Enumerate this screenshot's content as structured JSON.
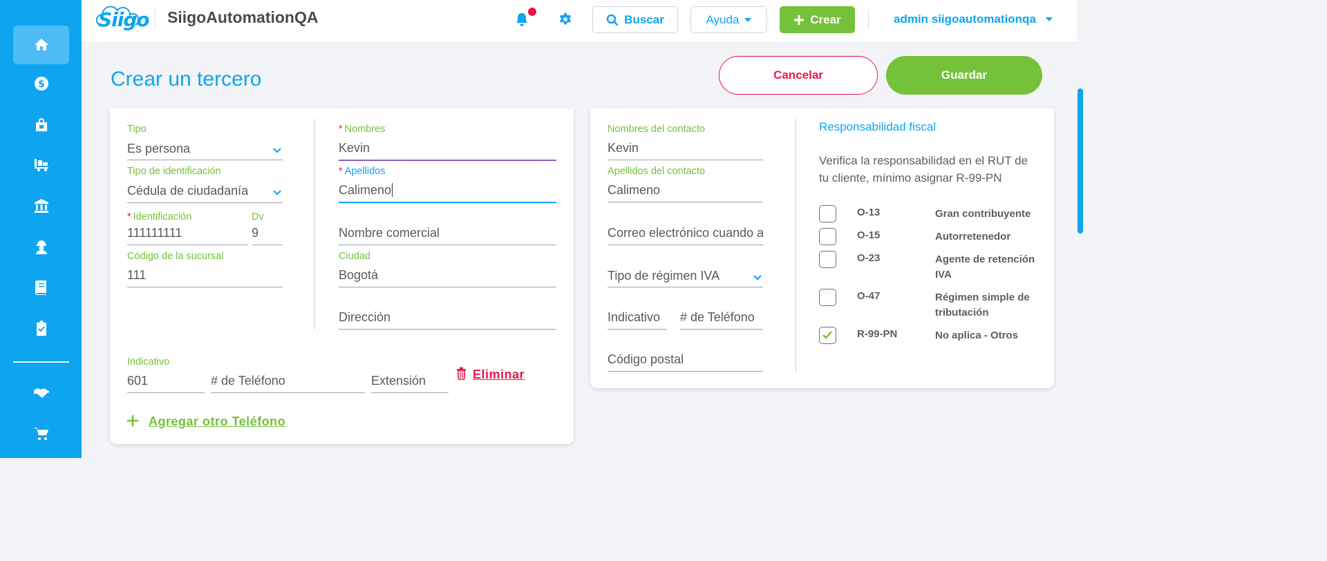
{
  "app": {
    "logo_text": "Siigo",
    "company_name": "SiigoAutomationQA",
    "accent_color": "#0ea5f0",
    "success_color": "#74c13a",
    "danger_color": "#e8174b"
  },
  "header": {
    "search_label": "Buscar",
    "help_label": "Ayuda",
    "create_label": "Crear",
    "user_label": "admin siigoautomationqa"
  },
  "sidebar": {
    "items": [
      {
        "icon": "home-icon",
        "active": true
      },
      {
        "icon": "dollar-icon"
      },
      {
        "icon": "shopping-bag-icon"
      },
      {
        "icon": "cart-truck-icon"
      },
      {
        "icon": "bank-icon"
      },
      {
        "icon": "worker-icon"
      },
      {
        "icon": "book-icon"
      },
      {
        "icon": "clipboard-check-icon"
      },
      {
        "icon": "handshake-icon"
      },
      {
        "icon": "shopping-cart-icon"
      }
    ]
  },
  "page": {
    "title": "Crear un tercero",
    "cancel_label": "Cancelar",
    "save_label": "Guardar"
  },
  "form_left": {
    "tipo_label": "Tipo",
    "tipo_value": "Es persona",
    "tipo_id_label": "Tipo de identificación",
    "tipo_id_value": "Cédula de ciudadanía",
    "identificacion_label": "Identificación",
    "identificacion_value": "111111111",
    "dv_label": "Dv",
    "dv_value": "9",
    "sucursal_label": "Código de la sucursal",
    "sucursal_value": "111",
    "nombres_label": "Nombres",
    "nombres_value": "Kevin",
    "apellidos_label": "Apellidos",
    "apellidos_value": "Calimeno",
    "nombre_comercial_placeholder": "Nombre comercial",
    "ciudad_label": "Ciudad",
    "ciudad_value": "Bogotá",
    "direccion_placeholder": "Dirección",
    "indicativo_label": "Indicativo",
    "indicativo_value": "601",
    "telefono_placeholder": "# de Teléfono",
    "extension_placeholder": "Extensión",
    "eliminar_label": "Eliminar",
    "agregar_telefono_label": "Agregar otro Teléfono"
  },
  "form_right": {
    "contacto_nombres_label": "Nombres del contacto",
    "contacto_nombres_value": "Kevin",
    "contacto_apellidos_label": "Apellidos del contacto",
    "contacto_apellidos_value": "Calimeno",
    "correo_placeholder": "Correo electrónico cuando a",
    "regimen_placeholder": "Tipo de régimen IVA",
    "indicativo_placeholder": "Indicativo",
    "telefono_placeholder": "# de Teléfono",
    "codigo_postal_placeholder": "Código postal"
  },
  "responsabilidad": {
    "title": "Responsabilidad fiscal",
    "description": "Verifica la responsabilidad en el RUT de tu cliente, mínimo asignar R-99-PN",
    "items": [
      {
        "code": "O-13",
        "name": "Gran contribuyente",
        "checked": false
      },
      {
        "code": "O-15",
        "name": "Autorretenedor",
        "checked": false
      },
      {
        "code": "O-23",
        "name": "Agente de retención IVA",
        "checked": false
      },
      {
        "code": "O-47",
        "name": "Régimen simple de tributación",
        "checked": false
      },
      {
        "code": "R-99-PN",
        "name": "No aplica - Otros",
        "checked": true
      }
    ]
  }
}
